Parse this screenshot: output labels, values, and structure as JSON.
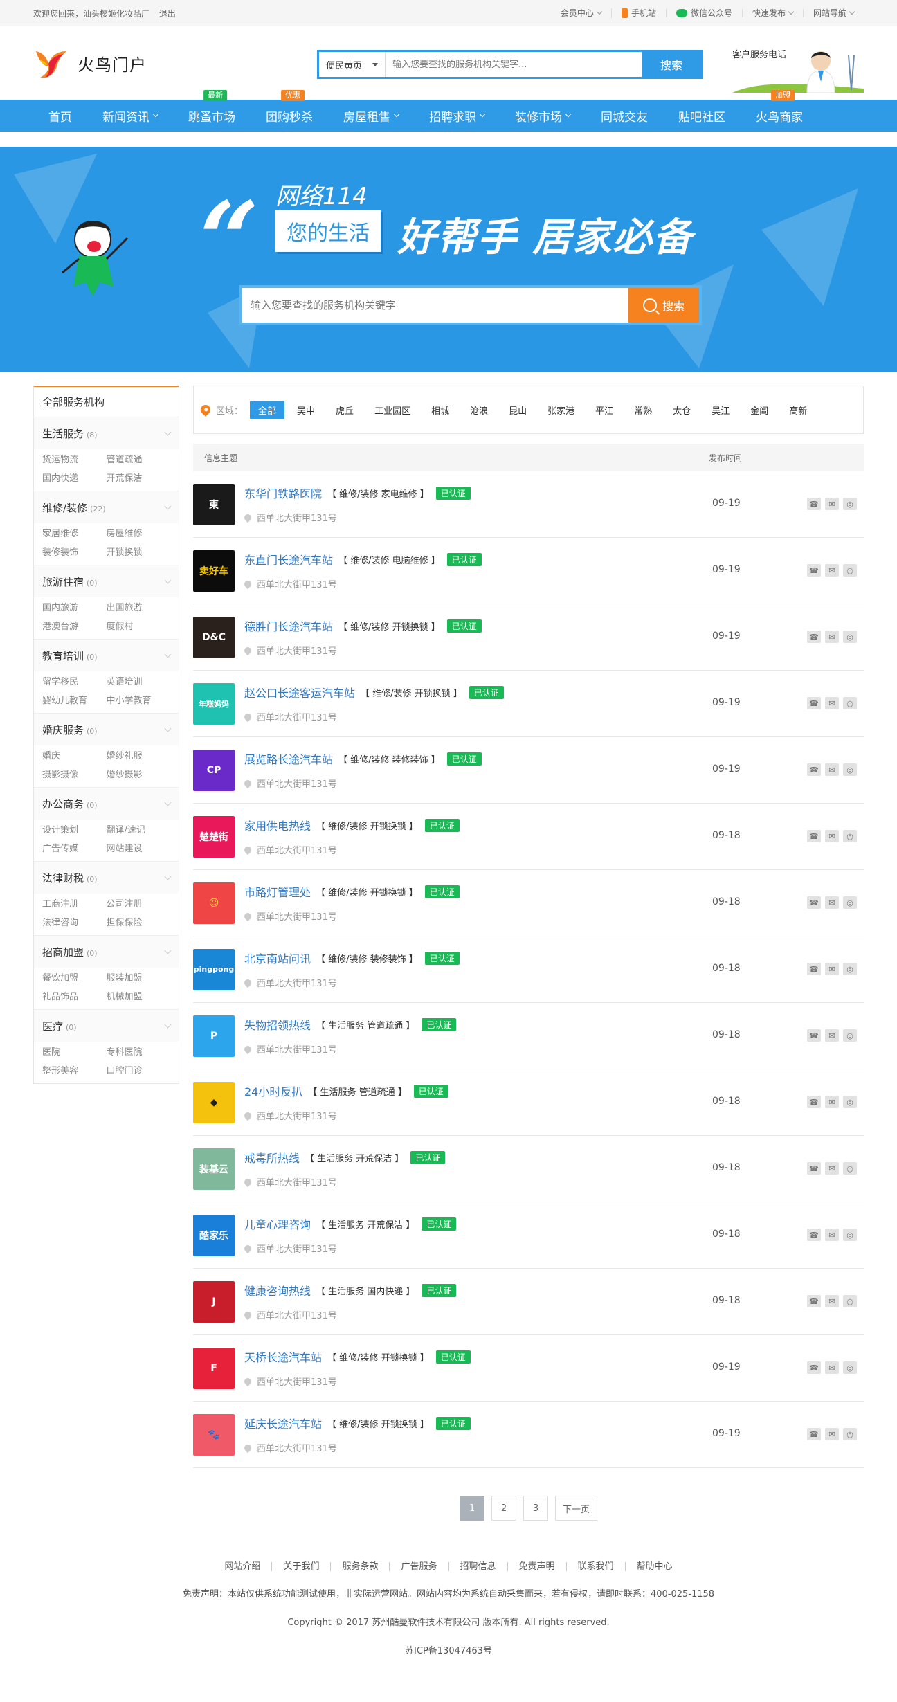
{
  "topbar": {
    "welcome": "欢迎您回来，汕头樱姬化妆品厂",
    "logout": "退出",
    "member": "会员中心",
    "mobile": "手机站",
    "wechat": "微信公众号",
    "publish": "快速发布",
    "sitenav": "网站导航"
  },
  "header": {
    "brand": "火鸟门户",
    "search_select": "便民黄页",
    "search_placeholder": "输入您要查找的服务机构关键字...",
    "search_button": "搜索",
    "service_label": "客户服务电话"
  },
  "nav": [
    {
      "label": "首页",
      "chev": false,
      "tag": "",
      "tag_color": ""
    },
    {
      "label": "新闻资讯",
      "chev": true,
      "tag": "",
      "tag_color": ""
    },
    {
      "label": "跳蚤市场",
      "chev": false,
      "tag": "最新",
      "tag_color": "#19b955"
    },
    {
      "label": "团购秒杀",
      "chev": false,
      "tag": "优惠",
      "tag_color": "#f5811f"
    },
    {
      "label": "房屋租售",
      "chev": true,
      "tag": "",
      "tag_color": ""
    },
    {
      "label": "招聘求职",
      "chev": true,
      "tag": "",
      "tag_color": ""
    },
    {
      "label": "装修市场",
      "chev": true,
      "tag": "",
      "tag_color": ""
    },
    {
      "label": "同城交友",
      "chev": false,
      "tag": "",
      "tag_color": ""
    },
    {
      "label": "贴吧社区",
      "chev": false,
      "tag": "",
      "tag_color": ""
    },
    {
      "label": "火鸟商家",
      "chev": false,
      "tag": "加盟",
      "tag_color": "#f5811f"
    }
  ],
  "banner": {
    "net": "网络114",
    "life": "您的生活",
    "slogan": "好帮手 居家必备",
    "search_placeholder": "输入您要查找的服务机构关键字",
    "search_button": "搜索"
  },
  "sidebar": {
    "title": "全部服务机构",
    "categories": [
      {
        "name": "生活服务",
        "count": "(8)",
        "links": [
          "货运物流",
          "管道疏通",
          "国内快递",
          "开荒保洁"
        ]
      },
      {
        "name": "维修/装修",
        "count": "(22)",
        "links": [
          "家居维修",
          "房屋维修",
          "装修装饰",
          "开锁换锁"
        ]
      },
      {
        "name": "旅游住宿",
        "count": "(0)",
        "links": [
          "国内旅游",
          "出国旅游",
          "港澳台游",
          "度假村"
        ]
      },
      {
        "name": "教育培训",
        "count": "(0)",
        "links": [
          "留学移民",
          "英语培训",
          "婴幼儿教育",
          "中小学教育"
        ]
      },
      {
        "name": "婚庆服务",
        "count": "(0)",
        "links": [
          "婚庆",
          "婚纱礼服",
          "摄影摄像",
          "婚纱摄影"
        ]
      },
      {
        "name": "办公商务",
        "count": "(0)",
        "links": [
          "设计策划",
          "翻译/速记",
          "广告传媒",
          "网站建设"
        ]
      },
      {
        "name": "法律财税",
        "count": "(0)",
        "links": [
          "工商注册",
          "公司注册",
          "法律咨询",
          "担保保险"
        ]
      },
      {
        "name": "招商加盟",
        "count": "(0)",
        "links": [
          "餐饮加盟",
          "服装加盟",
          "礼品饰品",
          "机械加盟"
        ]
      },
      {
        "name": "医疗",
        "count": "(0)",
        "links": [
          "医院",
          "专科医院",
          "整形美容",
          "口腔门诊"
        ]
      }
    ]
  },
  "areas": {
    "label": "区域：",
    "items": [
      "全部",
      "吴中",
      "虎丘",
      "工业园区",
      "相城",
      "沧浪",
      "昆山",
      "张家港",
      "平江",
      "常熟",
      "太仓",
      "吴江",
      "金阊",
      "高新"
    ]
  },
  "table": {
    "col_subject": "信息主题",
    "col_time": "发布时间"
  },
  "listings": [
    {
      "name": "东华门铁路医院",
      "tags": "【 维修/装修 家电维修 】",
      "verified": "已认证",
      "address": "西单北大街甲131号",
      "date": "09-19",
      "logo_text": "東",
      "logo_bg": "#1a1a1a",
      "logo_fg": "#ffffff"
    },
    {
      "name": "东直门长途汽车站",
      "tags": "【 维修/装修 电脑维修 】",
      "verified": "已认证",
      "address": "西单北大街甲131号",
      "date": "09-19",
      "logo_text": "卖好车",
      "logo_bg": "#0c0c0c",
      "logo_fg": "#f6c800"
    },
    {
      "name": "德胜门长途汽车站",
      "tags": "【 维修/装修 开锁换锁 】",
      "verified": "已认证",
      "address": "西单北大街甲131号",
      "date": "09-19",
      "logo_text": "D&C",
      "logo_bg": "#2a211c",
      "logo_fg": "#ffffff"
    },
    {
      "name": "赵公口长途客运汽车站",
      "tags": "【 维修/装修 开锁换锁 】",
      "verified": "已认证",
      "address": "西单北大街甲131号",
      "date": "09-19",
      "logo_text": "年糕妈妈",
      "logo_bg": "#1fc2b1",
      "logo_fg": "#ffffff"
    },
    {
      "name": "展览路长途汽车站",
      "tags": "【 维修/装修 装修装饰 】",
      "verified": "已认证",
      "address": "西单北大街甲131号",
      "date": "09-19",
      "logo_text": "CP",
      "logo_bg": "#6a29c9",
      "logo_fg": "#ffffff"
    },
    {
      "name": "家用供电热线",
      "tags": "【 维修/装修 开锁换锁 】",
      "verified": "已认证",
      "address": "西单北大街甲131号",
      "date": "09-18",
      "logo_text": "楚楚街",
      "logo_bg": "#e8185a",
      "logo_fg": "#ffffff"
    },
    {
      "name": "市路灯管理处",
      "tags": "【 维修/装修 开锁换锁 】",
      "verified": "已认证",
      "address": "西单北大街甲131号",
      "date": "09-18",
      "logo_text": "☺",
      "logo_bg": "#f04545",
      "logo_fg": "#ffd23f"
    },
    {
      "name": "北京南站问讯",
      "tags": "【 维修/装修 装修装饰 】",
      "verified": "已认证",
      "address": "西单北大街甲131号",
      "date": "09-18",
      "logo_text": "pingpong",
      "logo_bg": "#1a86d6",
      "logo_fg": "#ffffff"
    },
    {
      "name": "失物招领热线",
      "tags": "【 生活服务 管道疏通 】",
      "verified": "已认证",
      "address": "西单北大街甲131号",
      "date": "09-18",
      "logo_text": "P",
      "logo_bg": "#2da5ec",
      "logo_fg": "#ffffff"
    },
    {
      "name": "24小时反扒",
      "tags": "【 生活服务 管道疏通 】",
      "verified": "已认证",
      "address": "西单北大街甲131号",
      "date": "09-18",
      "logo_text": "◆",
      "logo_bg": "#f4c20d",
      "logo_fg": "#222222"
    },
    {
      "name": "戒毒所热线",
      "tags": "【 生活服务 开荒保洁 】",
      "verified": "已认证",
      "address": "西单北大街甲131号",
      "date": "09-18",
      "logo_text": "装基云",
      "logo_bg": "#7fb89b",
      "logo_fg": "#ffffff"
    },
    {
      "name": "儿童心理咨询",
      "tags": "【 生活服务 开荒保洁 】",
      "verified": "已认证",
      "address": "西单北大街甲131号",
      "date": "09-18",
      "logo_text": "酷家乐",
      "logo_bg": "#1a7fd8",
      "logo_fg": "#ffffff"
    },
    {
      "name": "健康咨询热线",
      "tags": "【 生活服务 国内快递 】",
      "verified": "已认证",
      "address": "西单北大街甲131号",
      "date": "09-18",
      "logo_text": "J",
      "logo_bg": "#c81e2b",
      "logo_fg": "#ffffff"
    },
    {
      "name": "天桥长途汽车站",
      "tags": "【 维修/装修 开锁换锁 】",
      "verified": "已认证",
      "address": "西单北大街甲131号",
      "date": "09-19",
      "logo_text": "F",
      "logo_bg": "#e8213a",
      "logo_fg": "#ffffff"
    },
    {
      "name": "延庆长途汽车站",
      "tags": "【 维修/装修 开锁换锁 】",
      "verified": "已认证",
      "address": "西单北大街甲131号",
      "date": "09-19",
      "logo_text": "🐾",
      "logo_bg": "#f05a68",
      "logo_fg": "#ffffff"
    }
  ],
  "pager": {
    "pages": [
      "1",
      "2",
      "3"
    ],
    "next": "下一页",
    "current": "1"
  },
  "footer": {
    "links": [
      "网站介绍",
      "关于我们",
      "服务条款",
      "广告服务",
      "招聘信息",
      "免责声明",
      "联系我们",
      "帮助中心"
    ],
    "disclaimer": "免责声明：本站仅供系统功能测试使用，非实际运营网站。网站内容均为系统自动采集而来，若有侵权，请即时联系：400-025-1158",
    "copyright": "Copyright © 2017 苏州酷曼软件技术有限公司 版本所有. All rights reserved.",
    "icp": "苏ICP备13047463号"
  },
  "colors": {
    "primary": "#2f9ae6",
    "accent": "#f5811f",
    "verified": "#19b955"
  }
}
